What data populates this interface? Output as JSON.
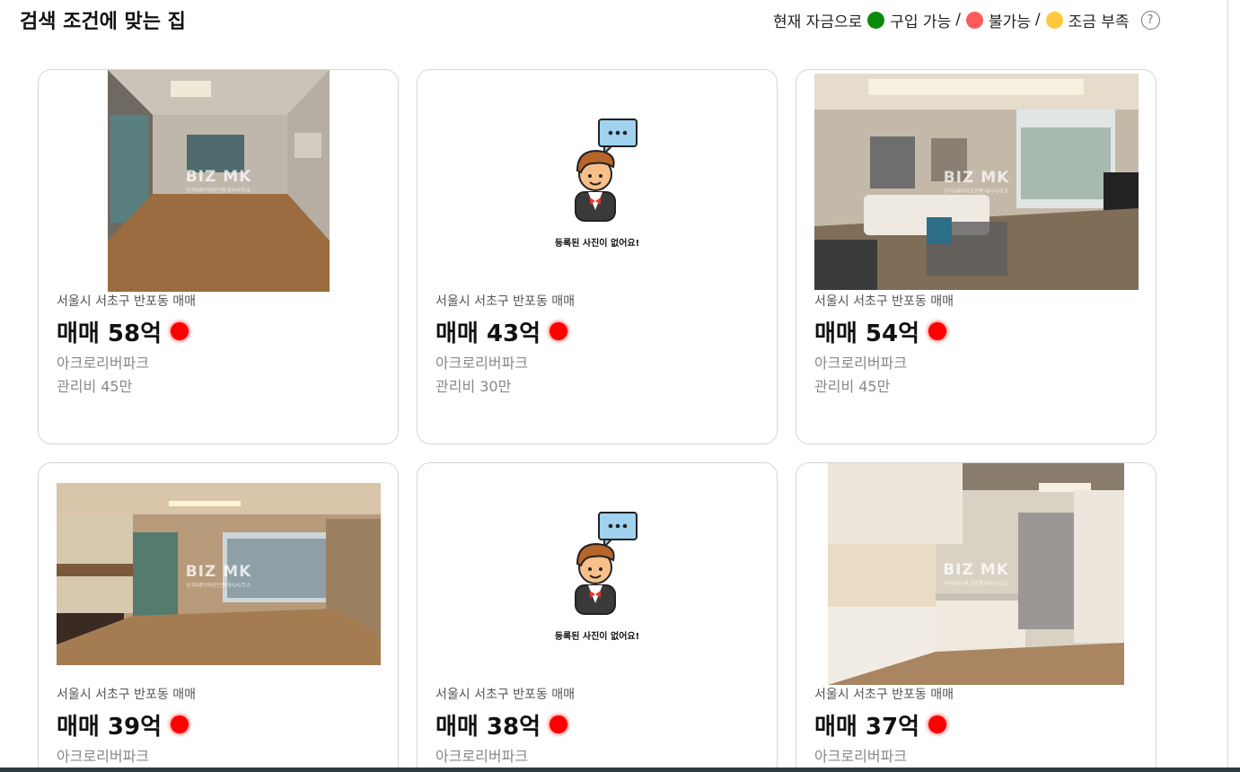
{
  "header": {
    "title": "검색 조건에 맞는 집",
    "legend": {
      "prefix": "현재 자금으로",
      "items": [
        {
          "label": "구입 가능",
          "color": "#0a8a0a"
        },
        {
          "label": "불가능",
          "color": "#ff5a5a"
        },
        {
          "label": "조금 부족",
          "color": "#ffc93c"
        }
      ],
      "separator": "/",
      "help_icon": "question-circle-icon",
      "help_glyph": "?"
    }
  },
  "no_photo_caption": "등록된 사진이 없어요!",
  "watermark": {
    "brand": "BIZ MK",
    "sub": "단지내타워공인중개사사무소"
  },
  "listings": [
    {
      "location": "서울시 서초구 반포동 매매",
      "price": "매매 58억",
      "complex": "아크로리버파크",
      "fee": "관리비 45만",
      "status": "불가능",
      "status_color": "#ff0000",
      "photo": "empty-living-room"
    },
    {
      "location": "서울시 서초구 반포동 매매",
      "price": "매매 43억",
      "complex": "아크로리버파크",
      "fee": "관리비 30만",
      "status": "불가능",
      "status_color": "#ff0000",
      "photo": "none"
    },
    {
      "location": "서울시 서초구 반포동 매매",
      "price": "매매 54억",
      "complex": "아크로리버파크",
      "fee": "관리비 45만",
      "status": "불가능",
      "status_color": "#ff0000",
      "photo": "furnished-living-room"
    },
    {
      "location": "서울시 서초구 반포동 매매",
      "price": "매매 39억",
      "complex": "아크로리버파크",
      "fee": "",
      "status": "불가능",
      "status_color": "#ff0000",
      "photo": "wood-interior-room"
    },
    {
      "location": "서울시 서초구 반포동 매매",
      "price": "매매 38억",
      "complex": "아크로리버파크",
      "fee": "",
      "status": "불가능",
      "status_color": "#ff0000",
      "photo": "none"
    },
    {
      "location": "서울시 서초구 반포동 매매",
      "price": "매매 37억",
      "complex": "아크로리버파크",
      "fee": "",
      "status": "불가능",
      "status_color": "#ff0000",
      "photo": "kitchen"
    }
  ]
}
